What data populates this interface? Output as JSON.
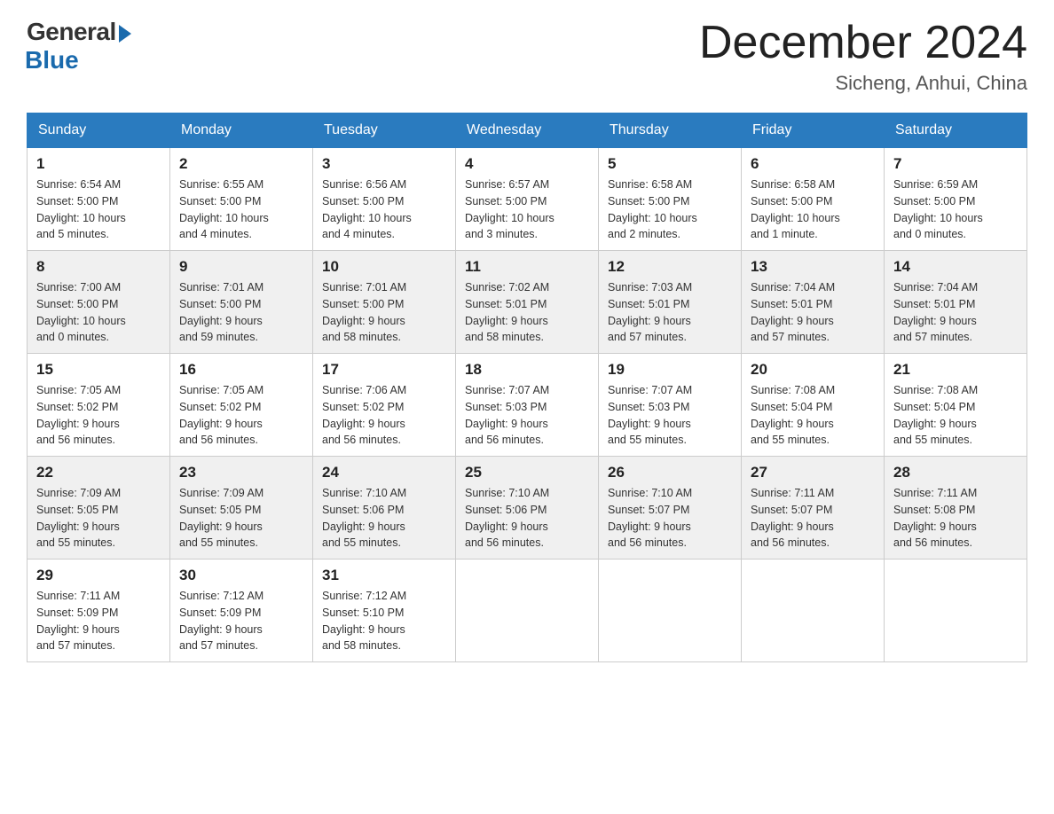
{
  "logo": {
    "general": "General",
    "blue": "Blue"
  },
  "title": "December 2024",
  "location": "Sicheng, Anhui, China",
  "days_of_week": [
    "Sunday",
    "Monday",
    "Tuesday",
    "Wednesday",
    "Thursday",
    "Friday",
    "Saturday"
  ],
  "weeks": [
    [
      {
        "day": "1",
        "sunrise": "6:54 AM",
        "sunset": "5:00 PM",
        "daylight": "10 hours and 5 minutes."
      },
      {
        "day": "2",
        "sunrise": "6:55 AM",
        "sunset": "5:00 PM",
        "daylight": "10 hours and 4 minutes."
      },
      {
        "day": "3",
        "sunrise": "6:56 AM",
        "sunset": "5:00 PM",
        "daylight": "10 hours and 4 minutes."
      },
      {
        "day": "4",
        "sunrise": "6:57 AM",
        "sunset": "5:00 PM",
        "daylight": "10 hours and 3 minutes."
      },
      {
        "day": "5",
        "sunrise": "6:58 AM",
        "sunset": "5:00 PM",
        "daylight": "10 hours and 2 minutes."
      },
      {
        "day": "6",
        "sunrise": "6:58 AM",
        "sunset": "5:00 PM",
        "daylight": "10 hours and 1 minute."
      },
      {
        "day": "7",
        "sunrise": "6:59 AM",
        "sunset": "5:00 PM",
        "daylight": "10 hours and 0 minutes."
      }
    ],
    [
      {
        "day": "8",
        "sunrise": "7:00 AM",
        "sunset": "5:00 PM",
        "daylight": "10 hours and 0 minutes."
      },
      {
        "day": "9",
        "sunrise": "7:01 AM",
        "sunset": "5:00 PM",
        "daylight": "9 hours and 59 minutes."
      },
      {
        "day": "10",
        "sunrise": "7:01 AM",
        "sunset": "5:00 PM",
        "daylight": "9 hours and 58 minutes."
      },
      {
        "day": "11",
        "sunrise": "7:02 AM",
        "sunset": "5:01 PM",
        "daylight": "9 hours and 58 minutes."
      },
      {
        "day": "12",
        "sunrise": "7:03 AM",
        "sunset": "5:01 PM",
        "daylight": "9 hours and 57 minutes."
      },
      {
        "day": "13",
        "sunrise": "7:04 AM",
        "sunset": "5:01 PM",
        "daylight": "9 hours and 57 minutes."
      },
      {
        "day": "14",
        "sunrise": "7:04 AM",
        "sunset": "5:01 PM",
        "daylight": "9 hours and 57 minutes."
      }
    ],
    [
      {
        "day": "15",
        "sunrise": "7:05 AM",
        "sunset": "5:02 PM",
        "daylight": "9 hours and 56 minutes."
      },
      {
        "day": "16",
        "sunrise": "7:05 AM",
        "sunset": "5:02 PM",
        "daylight": "9 hours and 56 minutes."
      },
      {
        "day": "17",
        "sunrise": "7:06 AM",
        "sunset": "5:02 PM",
        "daylight": "9 hours and 56 minutes."
      },
      {
        "day": "18",
        "sunrise": "7:07 AM",
        "sunset": "5:03 PM",
        "daylight": "9 hours and 56 minutes."
      },
      {
        "day": "19",
        "sunrise": "7:07 AM",
        "sunset": "5:03 PM",
        "daylight": "9 hours and 55 minutes."
      },
      {
        "day": "20",
        "sunrise": "7:08 AM",
        "sunset": "5:04 PM",
        "daylight": "9 hours and 55 minutes."
      },
      {
        "day": "21",
        "sunrise": "7:08 AM",
        "sunset": "5:04 PM",
        "daylight": "9 hours and 55 minutes."
      }
    ],
    [
      {
        "day": "22",
        "sunrise": "7:09 AM",
        "sunset": "5:05 PM",
        "daylight": "9 hours and 55 minutes."
      },
      {
        "day": "23",
        "sunrise": "7:09 AM",
        "sunset": "5:05 PM",
        "daylight": "9 hours and 55 minutes."
      },
      {
        "day": "24",
        "sunrise": "7:10 AM",
        "sunset": "5:06 PM",
        "daylight": "9 hours and 55 minutes."
      },
      {
        "day": "25",
        "sunrise": "7:10 AM",
        "sunset": "5:06 PM",
        "daylight": "9 hours and 56 minutes."
      },
      {
        "day": "26",
        "sunrise": "7:10 AM",
        "sunset": "5:07 PM",
        "daylight": "9 hours and 56 minutes."
      },
      {
        "day": "27",
        "sunrise": "7:11 AM",
        "sunset": "5:07 PM",
        "daylight": "9 hours and 56 minutes."
      },
      {
        "day": "28",
        "sunrise": "7:11 AM",
        "sunset": "5:08 PM",
        "daylight": "9 hours and 56 minutes."
      }
    ],
    [
      {
        "day": "29",
        "sunrise": "7:11 AM",
        "sunset": "5:09 PM",
        "daylight": "9 hours and 57 minutes."
      },
      {
        "day": "30",
        "sunrise": "7:12 AM",
        "sunset": "5:09 PM",
        "daylight": "9 hours and 57 minutes."
      },
      {
        "day": "31",
        "sunrise": "7:12 AM",
        "sunset": "5:10 PM",
        "daylight": "9 hours and 58 minutes."
      },
      null,
      null,
      null,
      null
    ]
  ]
}
